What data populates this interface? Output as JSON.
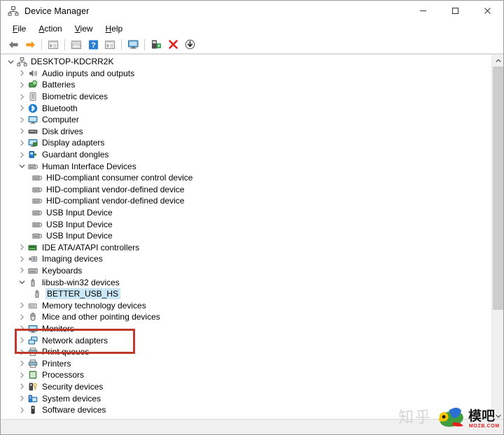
{
  "window": {
    "title": "Device Manager",
    "title_icon": "device-manager-icon"
  },
  "window_controls": {
    "minimize": "minimize-icon",
    "maximize": "maximize-icon",
    "close": "close-icon"
  },
  "menubar": {
    "items": [
      {
        "label": "File",
        "accel": "F"
      },
      {
        "label": "Action",
        "accel": "A"
      },
      {
        "label": "View",
        "accel": "V"
      },
      {
        "label": "Help",
        "accel": "H"
      }
    ]
  },
  "toolbar": {
    "buttons": [
      {
        "name": "back-icon",
        "tooltip": "Back"
      },
      {
        "name": "forward-icon",
        "tooltip": "Forward"
      },
      {
        "name": "separator-1",
        "tooltip": ""
      },
      {
        "name": "show-hide-console-tree-icon",
        "tooltip": "Show/Hide Console Tree"
      },
      {
        "name": "separator-2",
        "tooltip": ""
      },
      {
        "name": "properties-icon",
        "tooltip": "Properties"
      },
      {
        "name": "help-icon",
        "tooltip": "Help"
      },
      {
        "name": "view-icon",
        "tooltip": "View"
      },
      {
        "name": "separator-3",
        "tooltip": ""
      },
      {
        "name": "scan-for-hardware-changes-icon",
        "tooltip": "Scan for hardware changes"
      },
      {
        "name": "separator-4",
        "tooltip": ""
      },
      {
        "name": "update-driver-icon",
        "tooltip": "Update driver"
      },
      {
        "name": "uninstall-device-icon",
        "tooltip": "Uninstall device"
      },
      {
        "name": "disable-device-icon",
        "tooltip": "Disable device"
      }
    ]
  },
  "tree": {
    "nodes": [
      {
        "level": 0,
        "label": "DESKTOP-KDCRR2K",
        "icon": "computer-node-icon",
        "state": "expanded",
        "selected": false
      },
      {
        "level": 1,
        "label": "Audio inputs and outputs",
        "icon": "speaker-icon",
        "state": "collapsed",
        "selected": false
      },
      {
        "level": 1,
        "label": "Batteries",
        "icon": "battery-icon",
        "state": "collapsed",
        "selected": false
      },
      {
        "level": 1,
        "label": "Biometric devices",
        "icon": "fingerprint-icon",
        "state": "collapsed",
        "selected": false
      },
      {
        "level": 1,
        "label": "Bluetooth",
        "icon": "bluetooth-icon",
        "state": "collapsed",
        "selected": false
      },
      {
        "level": 1,
        "label": "Computer",
        "icon": "monitor-icon",
        "state": "collapsed",
        "selected": false
      },
      {
        "level": 1,
        "label": "Disk drives",
        "icon": "disk-drive-icon",
        "state": "collapsed",
        "selected": false
      },
      {
        "level": 1,
        "label": "Display adapters",
        "icon": "display-adapter-icon",
        "state": "collapsed",
        "selected": false
      },
      {
        "level": 1,
        "label": "Guardant dongles",
        "icon": "dongle-icon",
        "state": "collapsed",
        "selected": false
      },
      {
        "level": 1,
        "label": "Human Interface Devices",
        "icon": "hid-icon",
        "state": "expanded",
        "selected": false
      },
      {
        "level": 2,
        "label": "HID-compliant consumer control device",
        "icon": "hid-icon",
        "state": "leaf",
        "selected": false
      },
      {
        "level": 2,
        "label": "HID-compliant vendor-defined device",
        "icon": "hid-icon",
        "state": "leaf",
        "selected": false
      },
      {
        "level": 2,
        "label": "HID-compliant vendor-defined device",
        "icon": "hid-icon",
        "state": "leaf",
        "selected": false
      },
      {
        "level": 2,
        "label": "USB Input Device",
        "icon": "hid-icon",
        "state": "leaf",
        "selected": false
      },
      {
        "level": 2,
        "label": "USB Input Device",
        "icon": "hid-icon",
        "state": "leaf",
        "selected": false
      },
      {
        "level": 2,
        "label": "USB Input Device",
        "icon": "hid-icon",
        "state": "leaf",
        "selected": false
      },
      {
        "level": 1,
        "label": "IDE ATA/ATAPI controllers",
        "icon": "ide-controller-icon",
        "state": "collapsed",
        "selected": false
      },
      {
        "level": 1,
        "label": "Imaging devices",
        "icon": "imaging-device-icon",
        "state": "collapsed",
        "selected": false
      },
      {
        "level": 1,
        "label": "Keyboards",
        "icon": "keyboard-icon",
        "state": "collapsed",
        "selected": false
      },
      {
        "level": 1,
        "label": "libusb-win32 devices",
        "icon": "usb-icon",
        "state": "expanded",
        "selected": false
      },
      {
        "level": 2,
        "label": "BETTER_USB_HS",
        "icon": "usb-icon",
        "state": "leaf",
        "selected": true
      },
      {
        "level": 1,
        "label": "Memory technology devices",
        "icon": "memory-technology-icon",
        "state": "collapsed",
        "selected": false
      },
      {
        "level": 1,
        "label": "Mice and other pointing devices",
        "icon": "mouse-icon",
        "state": "collapsed",
        "selected": false
      },
      {
        "level": 1,
        "label": "Monitors",
        "icon": "monitor-icon",
        "state": "collapsed",
        "selected": false
      },
      {
        "level": 1,
        "label": "Network adapters",
        "icon": "network-adapter-icon",
        "state": "collapsed",
        "selected": false
      },
      {
        "level": 1,
        "label": "Print queues",
        "icon": "printer-icon",
        "state": "collapsed",
        "selected": false
      },
      {
        "level": 1,
        "label": "Printers",
        "icon": "printer-icon",
        "state": "collapsed",
        "selected": false
      },
      {
        "level": 1,
        "label": "Processors",
        "icon": "processor-icon",
        "state": "collapsed",
        "selected": false
      },
      {
        "level": 1,
        "label": "Security devices",
        "icon": "security-device-icon",
        "state": "collapsed",
        "selected": false
      },
      {
        "level": 1,
        "label": "System devices",
        "icon": "system-device-icon",
        "state": "collapsed",
        "selected": false
      },
      {
        "level": 1,
        "label": "Software devices",
        "icon": "software-device-icon",
        "state": "collapsed",
        "selected": false
      }
    ]
  },
  "annotation": {
    "highlight_color": "#c0392b",
    "highlights": "libusb-win32 devices / BETTER_USB_HS"
  },
  "selection": {
    "color": "#cce8f7",
    "selected_item": "BETTER_USB_HS"
  },
  "scrollbar": {
    "up_arrow": "chevron-up-icon",
    "down_arrow": "chevron-down-icon"
  },
  "watermark": {
    "zhihu_text": "知乎 @",
    "logo_text": "模吧",
    "logo_domain": "MOZB.COM"
  }
}
